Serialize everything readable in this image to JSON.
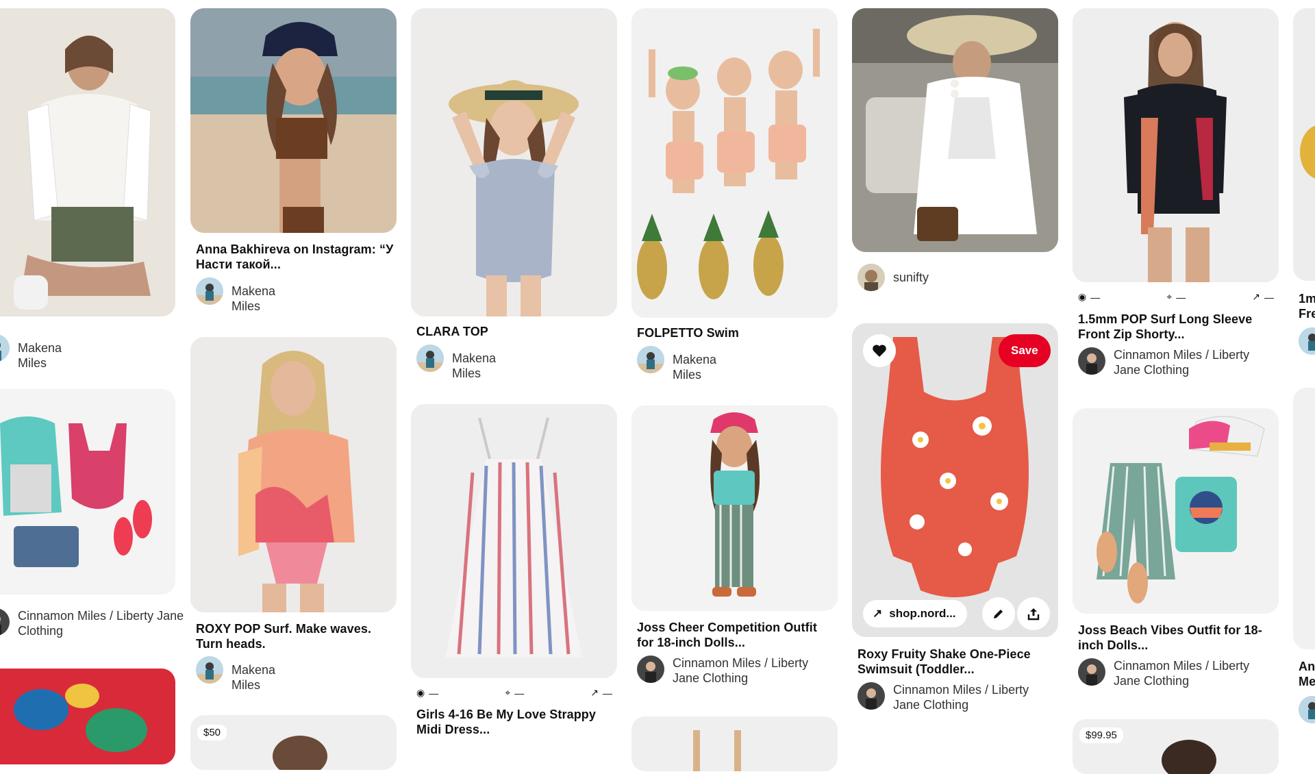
{
  "colors": {
    "save": "#e60023",
    "text": "#111111",
    "subtext": "#333333"
  },
  "pins": [
    {
      "creator": "Makena Miles"
    },
    {
      "title": "Anna Bakhireva on Instagram: “У Насти такой...",
      "creator": "Makena Miles"
    },
    {
      "title": "CLARA TOP",
      "creator": "Makena Miles"
    },
    {
      "title": "FOLPETTO Swim",
      "creator": "Makena Miles"
    },
    {
      "creator": "sunifty"
    },
    {
      "title": "1.5mm POP Surf Long Sleeve Front Zip Shorty...",
      "creator": "Cinnamon Miles / Liberty Jane Clothing"
    },
    {
      "creator": "Cinnamon Miles / Liberty Jane Clothing"
    },
    {
      "title": "ROXY POP Surf. Make waves. Turn heads.",
      "creator": "Makena Miles"
    },
    {
      "title": "Girls 4-16 Be My Love Strappy Midi Dress..."
    },
    {
      "title": "Joss Cheer Competition Outfit for 18-inch Dolls...",
      "creator": "Cinnamon Miles / Liberty Jane Clothing"
    },
    {
      "title": "Roxy Fruity Shake One-Piece Swimsuit (Toddler...",
      "creator": "Cinnamon Miles / Liberty Jane Clothing",
      "link": "shop.nord...",
      "save_label": "Save"
    },
    {
      "title": "Joss Beach Vibes Outfit for 18-inch Dolls...",
      "creator": "Cinnamon Miles / Liberty Jane Clothing"
    }
  ],
  "partial_titles": {
    "col7_top": "1m\nFre",
    "col7_bottom": "An\nMe"
  },
  "prices": [
    "$50",
    "$99.95"
  ],
  "stat_dash": "—"
}
